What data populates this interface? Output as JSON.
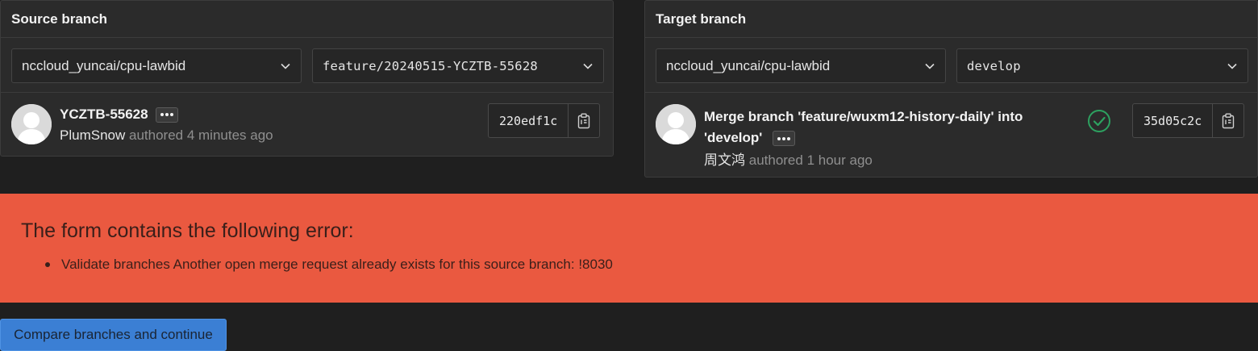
{
  "source": {
    "header": "Source branch",
    "project": "nccloud_yuncai/cpu-lawbid",
    "branch": "feature/20240515-YCZTB-55628",
    "commit": {
      "title": "YCZTB-55628",
      "author": "PlumSnow",
      "meta": "authored 4 minutes ago",
      "sha": "220edf1c"
    }
  },
  "target": {
    "header": "Target branch",
    "project": "nccloud_yuncai/cpu-lawbid",
    "branch": "develop",
    "commit": {
      "title_line1": "Merge branch 'feature/wuxm12-history-daily' into",
      "title_line2": "'develop'",
      "author": "周文鸿",
      "meta": "authored 1 hour ago",
      "sha": "35d05c2c",
      "status": "success"
    }
  },
  "error": {
    "title": "The form contains the following error:",
    "items": [
      "Validate branches Another open merge request already exists for this source branch: !8030"
    ]
  },
  "actions": {
    "compare_label": "Compare branches and continue"
  },
  "colors": {
    "error_bg": "#ea5940",
    "primary": "#3b7fd4",
    "success": "#2da160"
  },
  "icons": {
    "chevron": "chevron-down-icon",
    "copy": "copy-icon",
    "status": "check-circle-icon",
    "ellipsis": "ellipsis-icon",
    "avatar": "default-avatar-icon"
  }
}
